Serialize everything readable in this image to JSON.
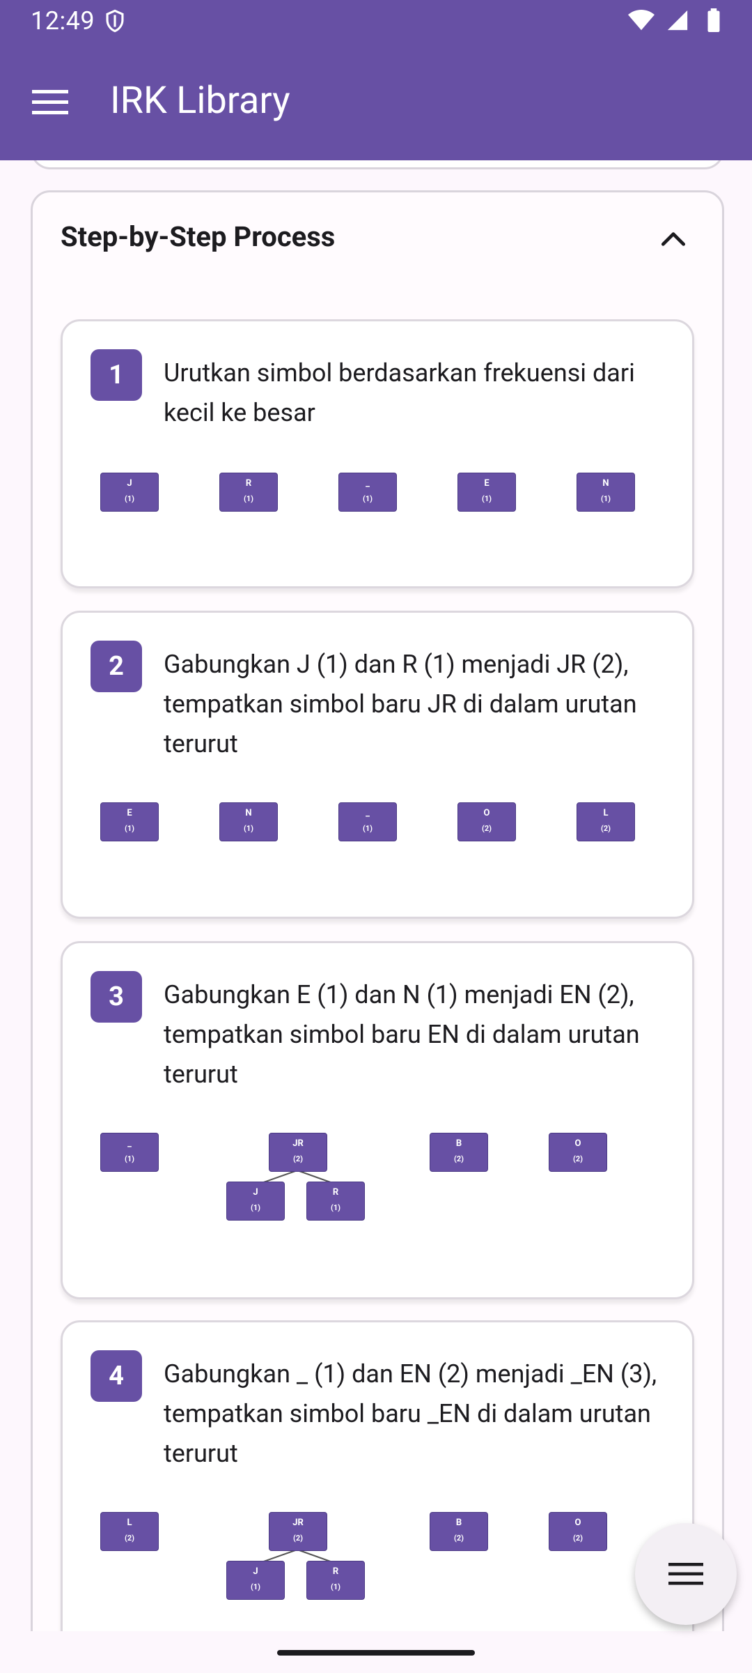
{
  "status_bar": {
    "time": "12:49"
  },
  "app_bar": {
    "title": "IRK Library"
  },
  "section": {
    "title": "Step-by-Step Process"
  },
  "steps": [
    {
      "number": "1",
      "text": "Urutkan simbol berdasarkan frekuensi dari kecil ke besar",
      "nodes": [
        {
          "s": "J",
          "f": "(1)"
        },
        {
          "s": "R",
          "f": "(1)"
        },
        {
          "s": "_",
          "f": "(1)"
        },
        {
          "s": "E",
          "f": "(1)"
        },
        {
          "s": "N",
          "f": "(1)"
        }
      ]
    },
    {
      "number": "2",
      "text": "Gabungkan J (1) dan R (1) menjadi JR (2), tempatkan simbol baru JR di dalam urutan terurut",
      "nodes": [
        {
          "s": "E",
          "f": "(1)"
        },
        {
          "s": "N",
          "f": "(1)"
        },
        {
          "s": "_",
          "f": "(1)"
        },
        {
          "s": "O",
          "f": "(2)"
        },
        {
          "s": "L",
          "f": "(2)"
        }
      ]
    },
    {
      "number": "3",
      "text": "Gabungkan E (1) dan N (1) menjadi EN (2), tempatkan simbol baru EN di dalam urutan terurut",
      "nodes": [
        {
          "s": "_",
          "f": "(1)"
        },
        {
          "s": "JR",
          "f": "(2)"
        },
        {
          "s": "J",
          "f": "(1)"
        },
        {
          "s": "R",
          "f": "(1)"
        },
        {
          "s": "B",
          "f": "(2)"
        },
        {
          "s": "O",
          "f": "(2)"
        }
      ]
    },
    {
      "number": "4",
      "text": "Gabungkan _ (1) dan EN (2) menjadi _EN (3), tempatkan simbol baru _EN di dalam urutan terurut",
      "nodes": [
        {
          "s": "L",
          "f": "(2)"
        },
        {
          "s": "JR",
          "f": "(2)"
        },
        {
          "s": "J",
          "f": "(1)"
        },
        {
          "s": "R",
          "f": "(1)"
        },
        {
          "s": "B",
          "f": "(2)"
        },
        {
          "s": "O",
          "f": "(2)"
        }
      ]
    }
  ],
  "icons": {
    "menu": "menu-icon",
    "collapse": "chevron-up-icon",
    "fab": "menu-icon",
    "shield": "shield-icon",
    "wifi": "wifi-icon",
    "signal": "signal-icon",
    "battery": "battery-icon"
  },
  "colors": {
    "primary": "#6750a4",
    "surface": "#fffbfe"
  }
}
